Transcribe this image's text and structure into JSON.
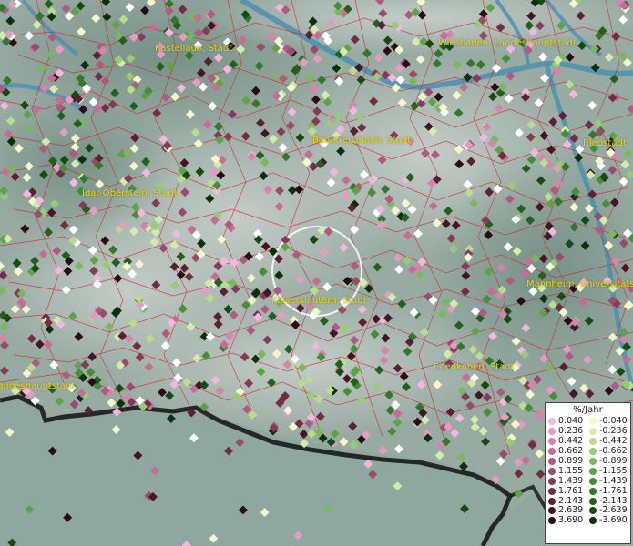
{
  "map": {
    "cities": [
      {
        "name": "Kastellaun, Stadt"
      },
      {
        "name": "Wiesbaden, Landeshauptstadt"
      },
      {
        "name": "Bad Kreuznach, Stadt"
      },
      {
        "name": "Riedstadt"
      },
      {
        "name": "Idar-Oberstein, Stadt"
      },
      {
        "name": "Kaiserslautern, Stadt"
      },
      {
        "name": "Mannheim, Universitätsstadt"
      },
      {
        "name": "Edenkoben, Stadt"
      },
      {
        "name": "Landeshauptstadt"
      }
    ]
  },
  "legend": {
    "title": "%/Jahr",
    "positive": [
      {
        "value": "0.040",
        "color": "#f3b6dc"
      },
      {
        "value": "0.236",
        "color": "#e89ac4"
      },
      {
        "value": "0.442",
        "color": "#d982ad"
      },
      {
        "value": "0.662",
        "color": "#c66c96"
      },
      {
        "value": "0.899",
        "color": "#b05a80"
      },
      {
        "value": "1.155",
        "color": "#9c4a6b"
      },
      {
        "value": "1.439",
        "color": "#873a57"
      },
      {
        "value": "1.761",
        "color": "#732c45"
      },
      {
        "value": "2.143",
        "color": "#5c1f34"
      },
      {
        "value": "2.639",
        "color": "#451425"
      },
      {
        "value": "3.690",
        "color": "#2d0a17"
      }
    ],
    "negative": [
      {
        "value": "-0.040",
        "color": "#f2fac8"
      },
      {
        "value": "-0.236",
        "color": "#d4ecaa"
      },
      {
        "value": "-0.442",
        "color": "#b7dd8d"
      },
      {
        "value": "-0.662",
        "color": "#98cc74"
      },
      {
        "value": "-0.899",
        "color": "#7ab85d"
      },
      {
        "value": "-1.155",
        "color": "#5ea447"
      },
      {
        "value": "-1.439",
        "color": "#458e35"
      },
      {
        "value": "-1.761",
        "color": "#327826"
      },
      {
        "value": "-2.143",
        "color": "#22611a"
      },
      {
        "value": "-2.639",
        "color": "#154a10"
      },
      {
        "value": "-3.690",
        "color": "#0a3208"
      }
    ]
  }
}
